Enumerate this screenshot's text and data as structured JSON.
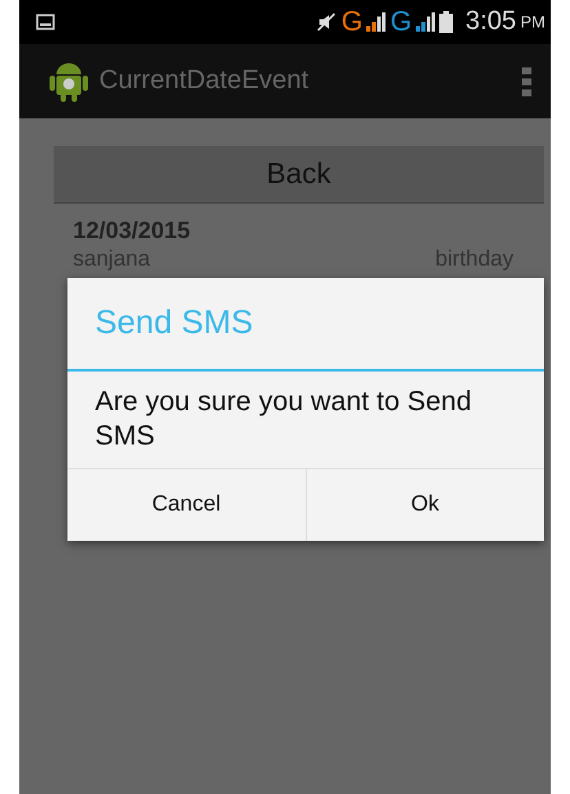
{
  "status_bar": {
    "networks": [
      {
        "label": "G",
        "color": "#e8700a"
      },
      {
        "label": "G",
        "color": "#1e8fd0"
      }
    ],
    "time": "3:05",
    "meridiem": "PM"
  },
  "action_bar": {
    "title": "CurrentDateEvent"
  },
  "back_button": "Back",
  "event": {
    "date": "12/03/2015",
    "name": "sanjana",
    "type": "birthday"
  },
  "dialog": {
    "title": "Send SMS",
    "message": "Are you sure you want to Send SMS",
    "buttons": [
      "Cancel",
      "Ok"
    ]
  }
}
